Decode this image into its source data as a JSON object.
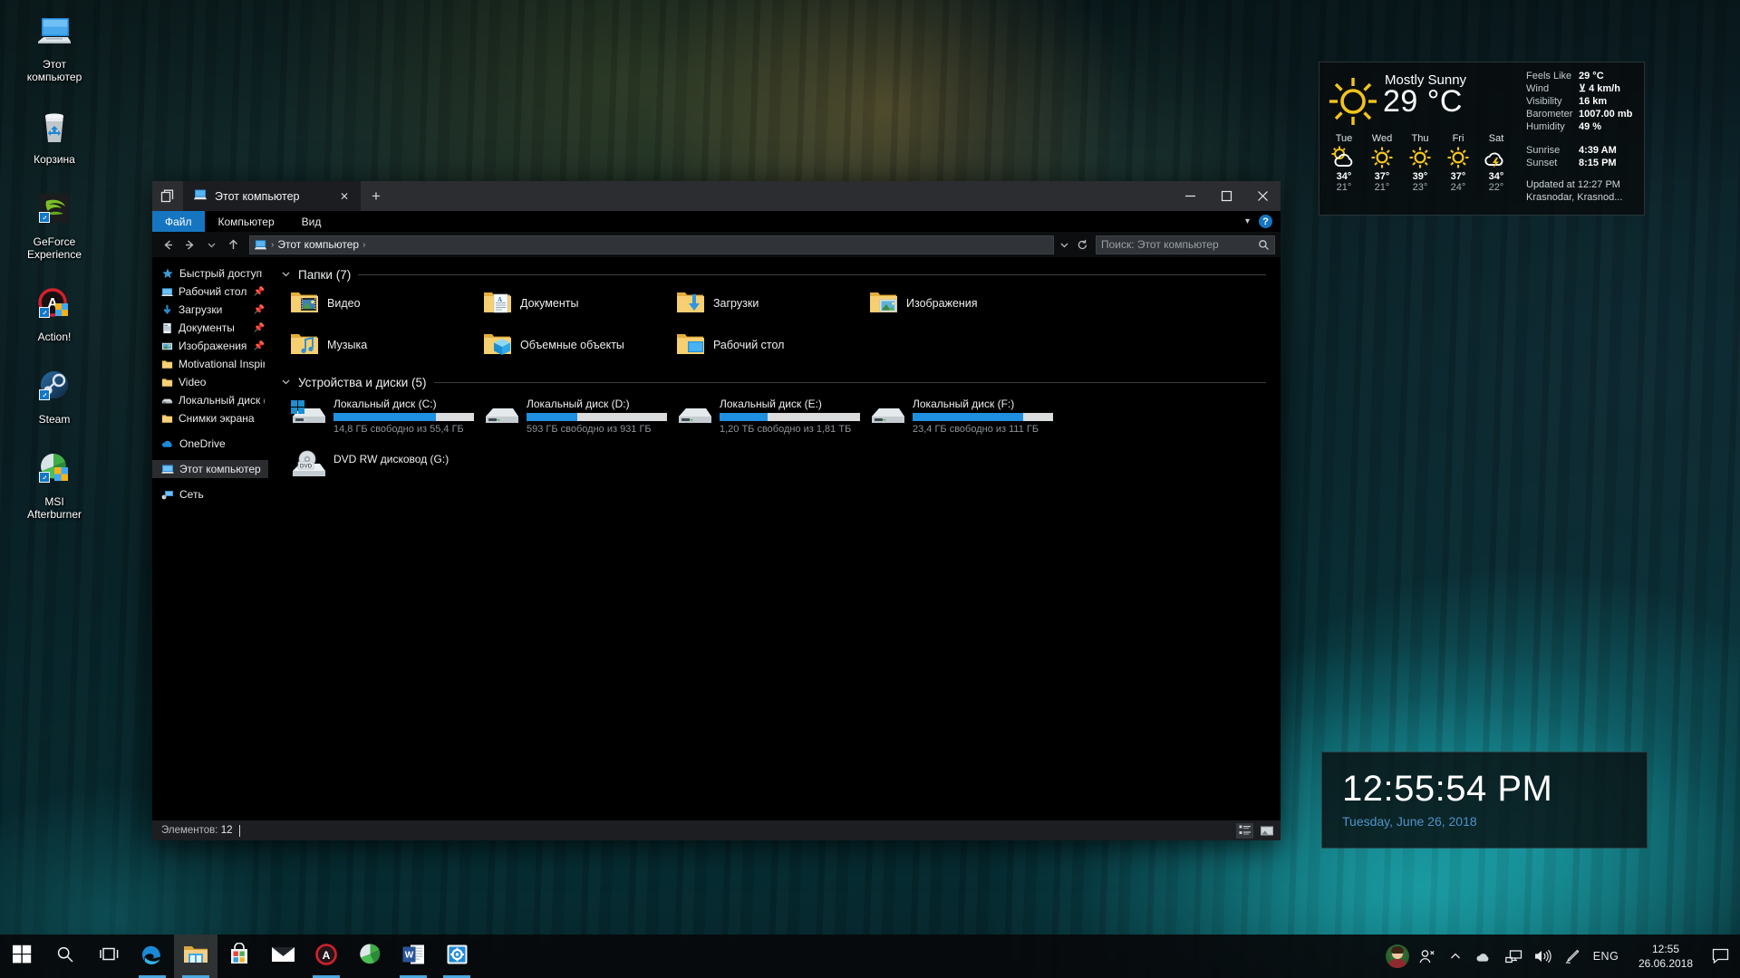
{
  "desktop": {
    "icons": [
      {
        "label": "Этот\nкомпьютер",
        "icon": "this-pc-icon",
        "name": "this-pc"
      },
      {
        "label": "Корзина",
        "icon": "recycle-bin-icon",
        "name": "recycle-bin"
      },
      {
        "label": "GeForce\nExperience",
        "icon": "geforce-experience-icon",
        "name": "geforce-experience"
      },
      {
        "label": "Action!",
        "icon": "action-recorder-icon",
        "name": "action"
      },
      {
        "label": "Steam",
        "icon": "steam-icon",
        "name": "steam"
      },
      {
        "label": "MSI\nAfterburner",
        "icon": "msi-afterburner-icon",
        "name": "msi-afterburner"
      }
    ]
  },
  "weather": {
    "condition": "Mostly Sunny",
    "temperature": "29 °C",
    "icon": "sun-icon",
    "forecast": [
      {
        "day": "Tue",
        "icon": "sun-cloud-icon",
        "high": "34°",
        "low": "21°"
      },
      {
        "day": "Wed",
        "icon": "sun-icon",
        "high": "37°",
        "low": "21°"
      },
      {
        "day": "Thu",
        "icon": "sun-icon",
        "high": "39°",
        "low": "23°"
      },
      {
        "day": "Fri",
        "icon": "sun-icon",
        "high": "37°",
        "low": "24°"
      },
      {
        "day": "Sat",
        "icon": "storm-cloud-icon",
        "high": "34°",
        "low": "22°"
      }
    ],
    "details": [
      {
        "key": "Feels Like",
        "value": "29 °C"
      },
      {
        "key": "Wind",
        "value": "⊻ 4 km/h"
      },
      {
        "key": "Visibility",
        "value": "16 km"
      },
      {
        "key": "Barometer",
        "value": "1007.00 mb"
      },
      {
        "key": "Humidity",
        "value": "49 %"
      }
    ],
    "sun": [
      {
        "key": "Sunrise",
        "value": "4:39 AM"
      },
      {
        "key": "Sunset",
        "value": "8:15 PM"
      }
    ],
    "updated": "Updated at 12:27 PM",
    "location": "Krasnodar, Krasnod..."
  },
  "clock": {
    "time": "12:55:54 PM",
    "date": "Tuesday, June 26, 2018",
    "date_color": "#4f93c9"
  },
  "explorer": {
    "tab": {
      "title": "Этот компьютер",
      "icon": "this-pc-icon"
    },
    "new_tab_label": "+",
    "close_tab_label": "✕",
    "window_controls": {
      "minimize": "—",
      "maximize": "☐",
      "close": "✕"
    },
    "ribbon": {
      "file": "Файл",
      "tabs": [
        "Компьютер",
        "Вид"
      ],
      "help_label": "?"
    },
    "address": {
      "back": "←",
      "forward": "→",
      "history": "⌄",
      "up": "↑",
      "crumb_icon": "this-pc-icon",
      "crumb": "Этот компьютер",
      "dropdown": "⌄",
      "refresh": "↻"
    },
    "search": {
      "placeholder": "Поиск: Этот компьютер",
      "icon": "search-icon"
    },
    "nav_pane": [
      {
        "label": "Быстрый доступ",
        "icon": "star-icon",
        "pinned": false,
        "indent": false,
        "selected": false
      },
      {
        "label": "Рабочий стол",
        "icon": "desktop-icon",
        "pinned": true,
        "indent": true,
        "selected": false
      },
      {
        "label": "Загрузки",
        "icon": "downloads-icon",
        "pinned": true,
        "indent": true,
        "selected": false
      },
      {
        "label": "Документы",
        "icon": "documents-icon",
        "pinned": true,
        "indent": true,
        "selected": false
      },
      {
        "label": "Изображения",
        "icon": "pictures-icon",
        "pinned": true,
        "indent": true,
        "selected": false
      },
      {
        "label": "Motivational Inspire",
        "icon": "folder-icon",
        "pinned": false,
        "indent": true,
        "selected": false
      },
      {
        "label": "Video",
        "icon": "folder-icon",
        "pinned": false,
        "indent": true,
        "selected": false
      },
      {
        "label": "Локальный диск (D",
        "icon": "drive-icon",
        "pinned": false,
        "indent": true,
        "selected": false
      },
      {
        "label": "Снимки экрана",
        "icon": "folder-icon",
        "pinned": false,
        "indent": true,
        "selected": false
      },
      {
        "label": "OneDrive",
        "icon": "onedrive-icon",
        "pinned": false,
        "indent": false,
        "selected": false
      },
      {
        "label": "Этот компьютер",
        "icon": "this-pc-icon",
        "pinned": false,
        "indent": false,
        "selected": true
      },
      {
        "label": "Сеть",
        "icon": "network-icon",
        "pinned": false,
        "indent": false,
        "selected": false
      }
    ],
    "groups": {
      "folders_title": "Папки (7)",
      "drives_title": "Устройства и диски (5)"
    },
    "folders": [
      {
        "name": "Видео",
        "icon": "folder-video-icon"
      },
      {
        "name": "Документы",
        "icon": "folder-documents-icon"
      },
      {
        "name": "Загрузки",
        "icon": "folder-downloads-icon"
      },
      {
        "name": "Изображения",
        "icon": "folder-pictures-icon"
      },
      {
        "name": "Музыка",
        "icon": "folder-music-icon"
      },
      {
        "name": "Объемные объекты",
        "icon": "folder-3dobjects-icon"
      },
      {
        "name": "Рабочий стол",
        "icon": "folder-desktop-icon"
      }
    ],
    "drives": [
      {
        "name": "Локальный диск (C:)",
        "free": "14,8 ГБ свободно из 55,4 ГБ",
        "used_percent": 73,
        "icon": "system-drive-icon",
        "has_bar": true
      },
      {
        "name": "Локальный диск (D:)",
        "free": "593 ГБ свободно из 931 ГБ",
        "used_percent": 36,
        "icon": "drive-icon",
        "has_bar": true
      },
      {
        "name": "Локальный диск (E:)",
        "free": "1,20 ТБ свободно из 1,81 ТБ",
        "used_percent": 34,
        "icon": "drive-icon",
        "has_bar": true
      },
      {
        "name": "Локальный диск (F:)",
        "free": "23,4 ГБ свободно из 111 ГБ",
        "used_percent": 79,
        "icon": "drive-icon",
        "has_bar": true
      },
      {
        "name": "DVD RW дисковод (G:)",
        "free": "",
        "used_percent": 0,
        "icon": "dvd-drive-icon",
        "has_bar": false
      }
    ],
    "status": {
      "items_label": "Элементов:",
      "items_count": "12",
      "view_tiles": "tiles-view-icon",
      "view_details": "details-view-icon"
    },
    "accent_color": "#1675c0",
    "bar_fill_color": "#1f8fe0"
  },
  "taskbar": {
    "start": "start-icon",
    "search": "search-icon",
    "taskview": "task-view-icon",
    "apps": [
      {
        "name": "edge-icon",
        "running": true,
        "active": false
      },
      {
        "name": "file-explorer-icon",
        "running": true,
        "active": true
      },
      {
        "name": "microsoft-store-icon",
        "running": false,
        "active": false
      },
      {
        "name": "mail-icon",
        "running": false,
        "active": false
      },
      {
        "name": "action-recorder-icon",
        "running": true,
        "active": false
      },
      {
        "name": "msi-afterburner-icon",
        "running": false,
        "active": false
      },
      {
        "name": "word-icon",
        "running": true,
        "active": false
      },
      {
        "name": "display-settings-icon",
        "running": true,
        "active": false
      }
    ],
    "tray": {
      "avatar": "user-avatar",
      "people": "people-icon",
      "chevron": "show-hidden-icons-chevron",
      "onedrive": "onedrive-tray-icon",
      "network": "network-tray-icon",
      "volume": "volume-tray-icon",
      "pen": "pen-tray-icon",
      "language": "ENG",
      "time": "12:55",
      "date": "26.06.2018",
      "action_center": "action-center-icon"
    }
  }
}
